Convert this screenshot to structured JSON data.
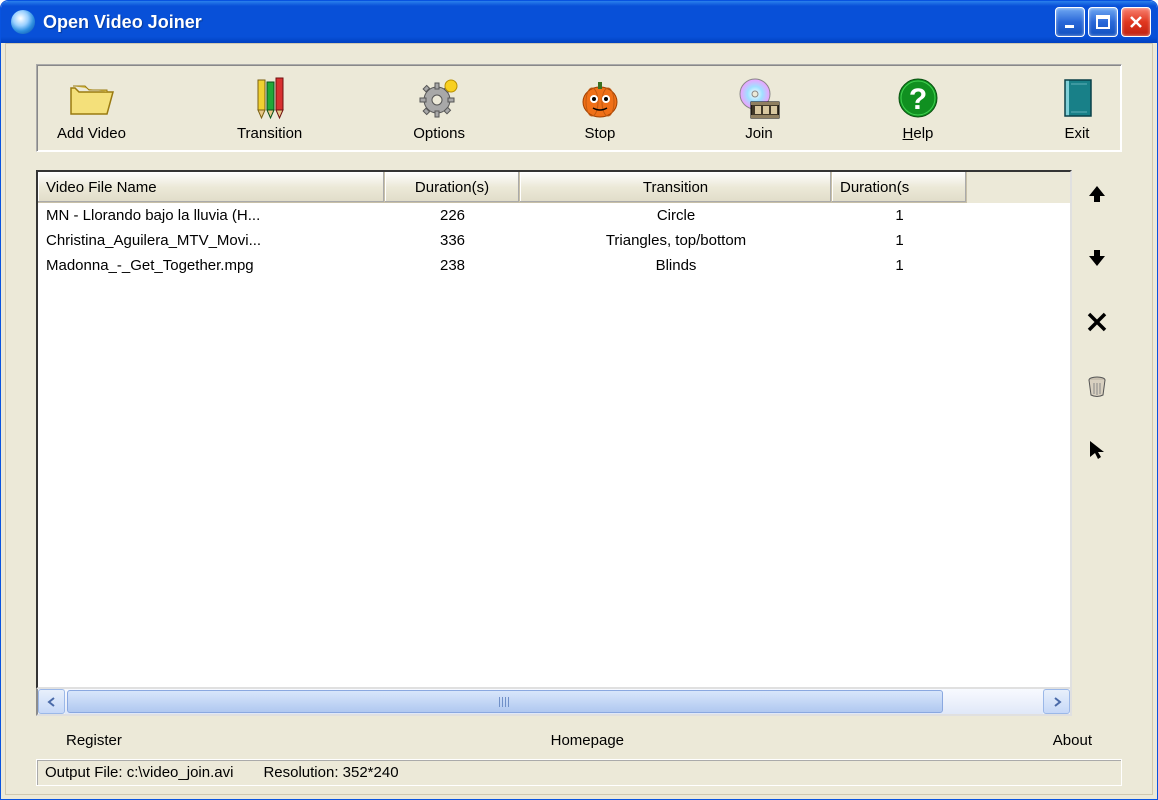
{
  "window": {
    "title": "Open Video Joiner"
  },
  "toolbar": [
    {
      "label": "Add Video",
      "icon": "folder-open-icon"
    },
    {
      "label": "Transition",
      "icon": "pencils-icon"
    },
    {
      "label": "Options",
      "icon": "gear-icon"
    },
    {
      "label": "Stop",
      "icon": "pumpkin-icon"
    },
    {
      "label": "Join",
      "icon": "disc-film-icon"
    },
    {
      "label": "Help",
      "icon": "help-icon",
      "underline_first": true
    },
    {
      "label": "Exit",
      "icon": "book-icon"
    }
  ],
  "columns": [
    {
      "label": "Video File Name"
    },
    {
      "label": "Duration(s)"
    },
    {
      "label": "Transition"
    },
    {
      "label": "Duration(s"
    }
  ],
  "rows": [
    {
      "name": "MN -  Llorando bajo la lluvia (H...",
      "duration": "226",
      "transition": "Circle",
      "tdur": "1"
    },
    {
      "name": "Christina_Aguilera_MTV_Movi...",
      "duration": "336",
      "transition": "Triangles, top/bottom",
      "tdur": "1"
    },
    {
      "name": "Madonna_-_Get_Together.mpg",
      "duration": "238",
      "transition": "Blinds",
      "tdur": "1"
    }
  ],
  "links": {
    "register": "Register",
    "homepage": "Homepage",
    "about": "About"
  },
  "status": {
    "output": "Output File: c:\\video_join.avi",
    "resolution": "Resolution: 352*240"
  }
}
